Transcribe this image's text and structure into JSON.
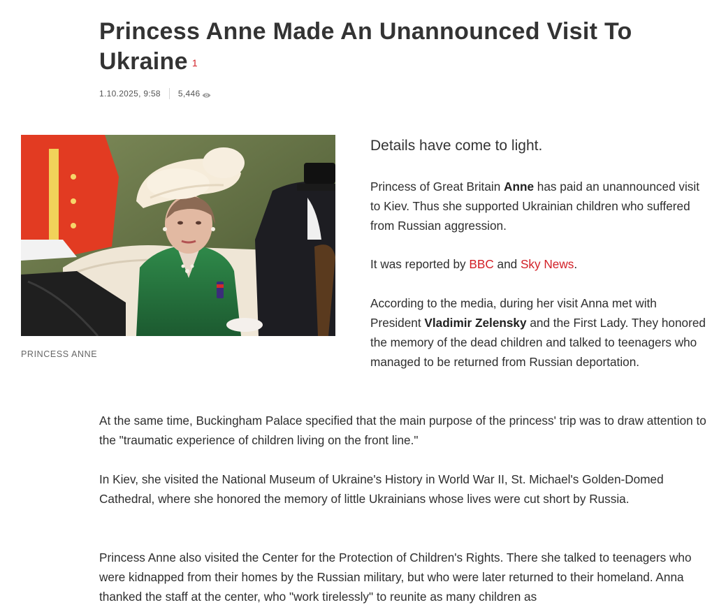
{
  "article": {
    "title": "Princess Anne Made An Unannounced Visit To Ukraine",
    "comments_count": "1",
    "date": "1.10.2025, 9:58",
    "views": "5,446",
    "views_icon": "eye-icon",
    "image_caption": "PRINCESS ANNE",
    "lead": "Details have come to light.",
    "p1": {
      "before": "Princess of Great Britain ",
      "bold": "Anne",
      "after": " has paid an unannounced visit to Kiev. Thus she supported Ukrainian children who suffered from Russian aggression."
    },
    "p2": {
      "before": "It was reported by ",
      "link1": "BBC",
      "middle": " and ",
      "link2": "Sky News",
      "after": "."
    },
    "p3": {
      "before": "According to the media, during her visit Anna met with President ",
      "bold": "Vladimir Zelensky",
      "after": " and the First Lady. They honored the memory of the dead children and talked to teenagers who managed to be returned from Russian deportation."
    },
    "p4": "At the same time, Buckingham Palace specified that the main purpose of the princess' trip was to draw attention to the \"traumatic experience of children living on the front line.\"",
    "p5": "In Kiev, she visited the National Museum of Ukraine's History in World War II, St. Michael's Golden-Domed Cathedral, where she honored the memory of little Ukrainians whose lives were cut short by Russia.",
    "p6": "Princess Anne also visited the Center for the Protection of Children's Rights. There she talked to teenagers who were kidnapped from their homes by the Russian military, but who were later returned to their homeland. Anna thanked the staff at the center, who \"work tirelessly\" to reunite as many children as"
  },
  "colors": {
    "accent_red": "#d21f26",
    "title": "#333333",
    "meta": "#555555"
  }
}
